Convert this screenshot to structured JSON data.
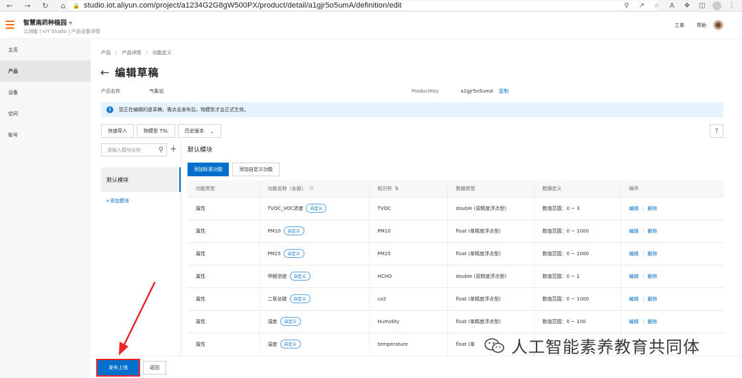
{
  "browser": {
    "url": "studio.iot.aliyun.com/project/a1234G2G8gW500PX/product/detail/a1gjr5o5umA/definition/edit"
  },
  "header": {
    "app_name": "智慧南药种植园",
    "app_sub": "公测版 | IoT Studio | 产品设备详情",
    "right_links": [
      "工单",
      "帮助"
    ]
  },
  "sidebar": {
    "items": [
      {
        "label": "主页"
      },
      {
        "label": "产品"
      },
      {
        "label": "设备"
      },
      {
        "label": "空间"
      },
      {
        "label": "账号"
      }
    ]
  },
  "breadcrumb": [
    "产品",
    "产品详情",
    "功能定义"
  ],
  "page_title": "编辑草稿",
  "meta": {
    "product_name_label": "产品名称",
    "product_name_value": "气象站",
    "product_key_label": "ProductKey",
    "product_key_value": "a1gjr5o5umA",
    "copy_label": "复制"
  },
  "notice": "您正在编辑的是草稿，需点击发布后，物模型才会正式生效。",
  "toolbar": {
    "quick_import": "快速导入",
    "tsl": "物模型 TSL",
    "history": "历史版本",
    "help": "?"
  },
  "modules": {
    "search_placeholder": "请输入模块名称",
    "default_module": "默认模块",
    "add_module": "+添加模块"
  },
  "content": {
    "section_title": "默认模块",
    "add_standard": "添加标准功能",
    "add_custom": "添加自定义功能",
    "columns": [
      "功能类型",
      "功能名称（全部）",
      "标识符",
      "数据类型",
      "数据定义",
      "操作"
    ],
    "tag_label": "自定义",
    "edit_label": "编辑",
    "delete_label": "删除",
    "rows": [
      {
        "type": "属性",
        "name": "TVOC_VOC浓度",
        "id": "TVOC",
        "dtype": "double (双精度浮点型)",
        "def": "数值范围：0 ~ 3"
      },
      {
        "type": "属性",
        "name": "PM10",
        "id": "PM10",
        "dtype": "float (单精度浮点型)",
        "def": "数值范围：0 ~ 1000"
      },
      {
        "type": "属性",
        "name": "PM25",
        "id": "PM25",
        "dtype": "float (单精度浮点型)",
        "def": "数值范围：0 ~ 1000"
      },
      {
        "type": "属性",
        "name": "甲醛浓度",
        "id": "HCHO",
        "dtype": "double (双精度浮点型)",
        "def": "数值范围：0 ~ 1"
      },
      {
        "type": "属性",
        "name": "二氧化碳",
        "id": "co2",
        "dtype": "float (单精度浮点型)",
        "def": "数值范围：0 ~ 1000"
      },
      {
        "type": "属性",
        "name": "湿度",
        "id": "Humidity",
        "dtype": "float (单精度浮点型)",
        "def": "数值范围：0 ~ 100"
      },
      {
        "type": "属性",
        "name": "温度",
        "id": "temperature",
        "dtype": "float (单",
        "def": ""
      }
    ]
  },
  "bottom": {
    "publish": "发布上线",
    "return": "返回"
  },
  "watermark": "人工智能素养教育共同体",
  "colors": {
    "primary": "#0070cc",
    "accent": "#ff6a00",
    "highlight": "#e8252b"
  }
}
